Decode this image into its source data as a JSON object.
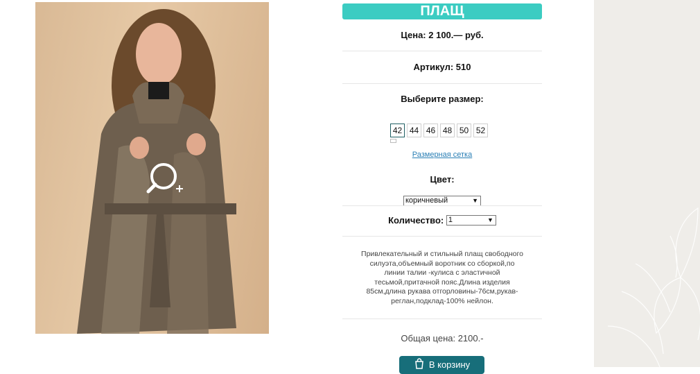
{
  "product": {
    "title": "ПЛАЩ",
    "price": "Цена: 2 100.— руб.",
    "article": "Артикул: 510",
    "choose_size": "Выберите размер:",
    "sizes": [
      "42",
      "44",
      "46",
      "48",
      "50",
      "52"
    ],
    "selected_size": "42",
    "size_chart_link": "Размерная сетка",
    "color_label": "Цвет:",
    "color_value": "коричневый",
    "quantity_label": "Количество:",
    "quantity_value": "1",
    "description": "Привлекательный и стильный плащ свободного силуэта,объемный воротник со сборкой,по линии талии -кулиса с эластичной тесьмой,притачной пояс.Длина изделия 85см,длина рукава отгорловины-76см,рукав-реглан,подклад-100% нейлон.",
    "total": "Общая цена: 2100.-",
    "add_to_cart": "В корзину"
  },
  "icons": {
    "zoom": "zoom-in-icon",
    "cart": "shopping-bag-icon"
  },
  "colors": {
    "title_bar": "#3cccc2",
    "cart_button": "#176e7a",
    "link": "#2a7fb5",
    "side_panel": "#efede9"
  }
}
